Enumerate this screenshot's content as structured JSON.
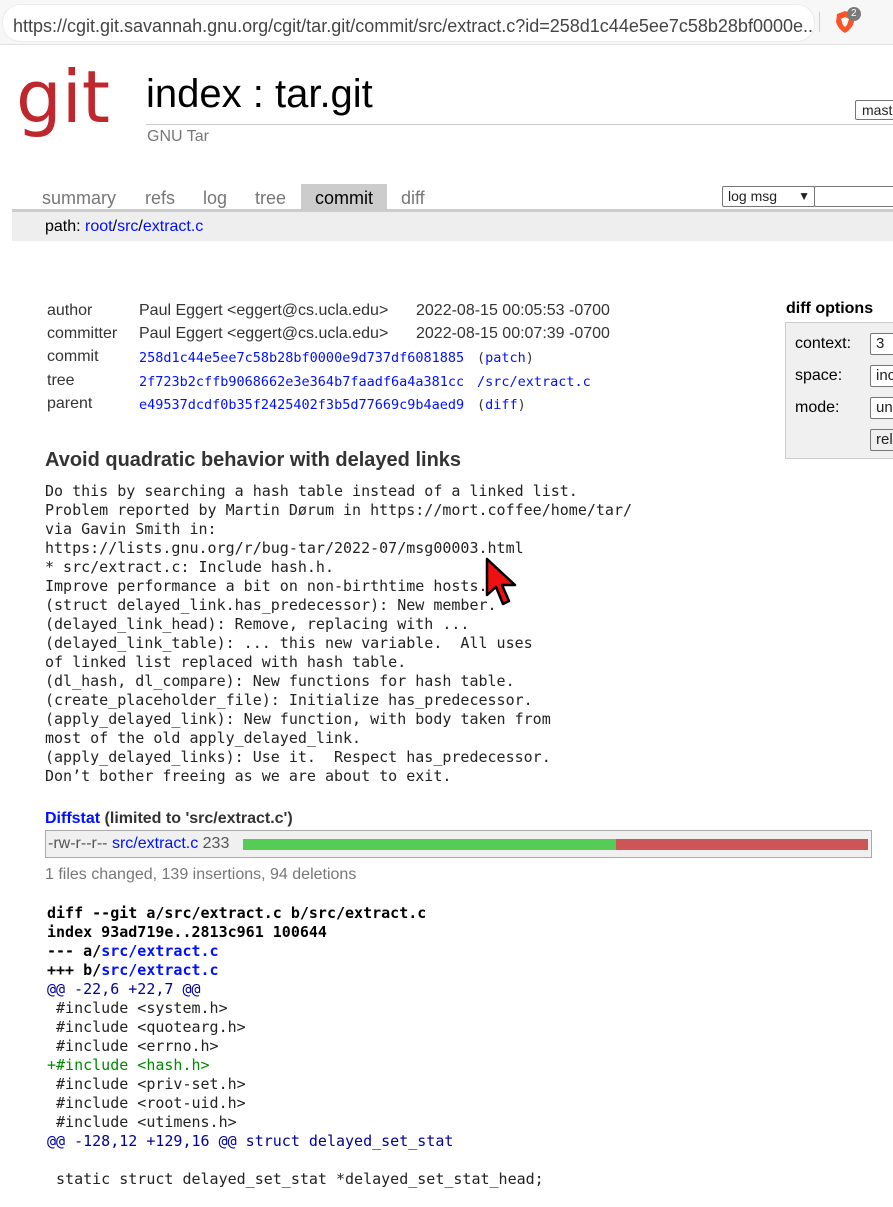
{
  "browser": {
    "url": "https://cgit.git.savannah.gnu.org/cgit/tar.git/commit/src/extract.c?id=258d1c44e5ee7c58b28bf0000e...",
    "shield_badge": "2"
  },
  "header": {
    "logo_text": "git",
    "title": "index : tar.git",
    "description": "GNU Tar",
    "branch_select": "master"
  },
  "tabs": [
    {
      "label": "summary"
    },
    {
      "label": "refs"
    },
    {
      "label": "log"
    },
    {
      "label": "tree"
    },
    {
      "label": "commit",
      "active": true
    },
    {
      "label": "diff"
    }
  ],
  "search": {
    "select_value": "log msg"
  },
  "path": {
    "prefix": "path: ",
    "root": "root",
    "sep1": "/",
    "dir": "src",
    "sep2": "/",
    "file": "extract.c"
  },
  "commit_info": {
    "author_label": "author",
    "author_name": "Paul Eggert <eggert@cs.ucla.edu>",
    "author_date": "2022-08-15 00:05:53 -0700",
    "committer_label": "committer",
    "committer_name": "Paul Eggert <eggert@cs.ucla.edu>",
    "committer_date": "2022-08-15 00:07:39 -0700",
    "commit_label": "commit",
    "commit_hash": "258d1c44e5ee7c58b28bf0000e9d737df6081885",
    "commit_patch": "patch",
    "tree_label": "tree",
    "tree_hash": "2f723b2cffb9068662e3e364b7faadf6a4a381cc",
    "tree_path": "/src/extract.c",
    "parent_label": "parent",
    "parent_hash": "e49537dcdf0b35f2425402f3b5d77669c9b4aed9",
    "parent_diff": "diff"
  },
  "diff_options": {
    "title": "diff options",
    "context_label": "context:",
    "context_value": "3",
    "space_label": "space:",
    "space_value": "include",
    "mode_label": "mode:",
    "mode_value": "unified",
    "reload_label": "reload"
  },
  "message": {
    "subject": "Avoid quadratic behavior with delayed links",
    "body": "Do this by searching a hash table instead of a linked list.\nProblem reported by Martin Dørum in https://mort.coffee/home/tar/\nvia Gavin Smith in:\nhttps://lists.gnu.org/r/bug-tar/2022-07/msg00003.html\n* src/extract.c: Include hash.h.\nImprove performance a bit on non-birthtime hosts.\n(struct delayed_link.has_predecessor): New member.\n(delayed_link_head): Remove, replacing with ...\n(delayed_link_table): ... this new variable.  All uses\nof linked list replaced with hash table.\n(dl_hash, dl_compare): New functions for hash table.\n(create_placeholder_file): Initialize has_predecessor.\n(apply_delayed_link): New function, with body taken from\nmost of the old apply_delayed_link.\n(apply_delayed_links): Use it.  Respect has_predecessor.\nDon’t bother freeing as we are about to exit."
  },
  "diffstat": {
    "title_link": "Diffstat",
    "title_rest": " (limited to 'src/extract.c')",
    "mode": "-rw-r--r--",
    "file": "src/extract.c",
    "changes": "233",
    "insertions": 139,
    "deletions": 94,
    "summary": "1 files changed, 139 insertions, 94 deletions",
    "colors": {
      "insert": "#55cc55",
      "delete": "#cc5555"
    }
  },
  "diff": {
    "line1": "diff --git a/src/extract.c b/src/extract.c",
    "line2": "index 93ad719e..2813c961 100644",
    "line3_prefix": "--- a/",
    "line3_file": "src/extract.c",
    "line4_prefix": "+++ b/",
    "line4_file": "src/extract.c",
    "hunk1": "@@ -22,6 +22,7 @@",
    "c1": " #include <system.h>",
    "c2": " #include <quotearg.h>",
    "c3": " #include <errno.h>",
    "a1": "+#include <hash.h>",
    "c4": " #include <priv-set.h>",
    "c5": " #include <root-uid.h>",
    "c6": " #include <utimens.h>",
    "hunk2": "@@ -128,12 +129,16 @@ struct delayed_set_stat",
    "c7": "",
    "c8": " static struct delayed_set_stat *delayed_set_stat_head;"
  }
}
